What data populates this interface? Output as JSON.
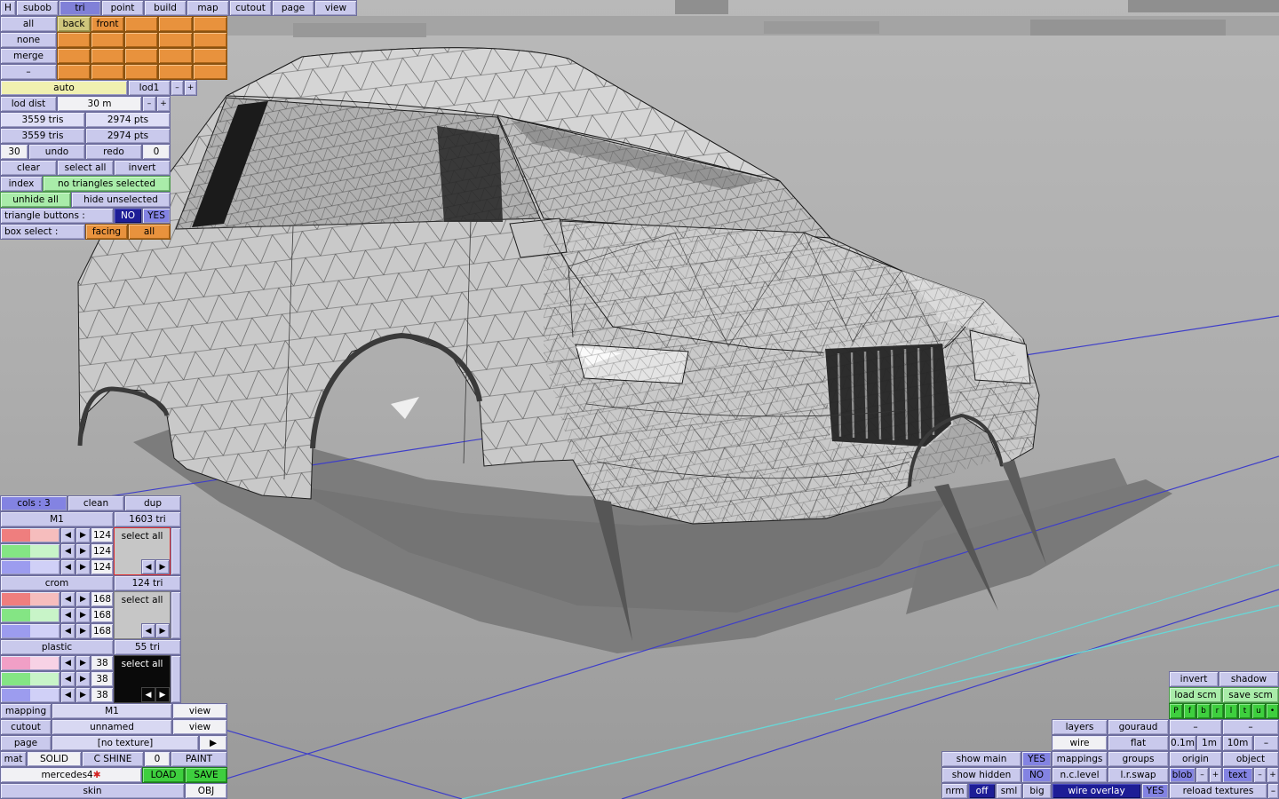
{
  "colors": {
    "panel": "#c9c9ec",
    "orange": "#e8923d",
    "yellow": "#f0f0b0",
    "tan": "#cfc67c",
    "green_light": "#a9eca9",
    "green_bright": "#3ecf3e",
    "blue_mid": "#8383e2",
    "navy": "#1d1d96",
    "viewport_gray": "#aeaeae",
    "shadow_gray": "#7c7c7c",
    "grid_blue": "#3e3ec9",
    "grid_cyan": "#68d6d6"
  },
  "menubar": {
    "h": "H",
    "items": [
      "subob",
      "tri",
      "point",
      "build",
      "map",
      "cutout",
      "page",
      "view"
    ],
    "active": "tri"
  },
  "subobject": {
    "side_buttons": [
      "all",
      "none",
      "merge",
      "–"
    ],
    "back": "back",
    "front": "front"
  },
  "lod": {
    "auto": "auto",
    "lod1": "lod1",
    "minus": "–",
    "plus": "+",
    "dist_label": "lod dist",
    "dist_value": "30 m",
    "dist_minus": "–",
    "dist_plus": "+"
  },
  "stats": {
    "row1_tris": "3559 tris",
    "row1_pts": "2974 pts",
    "row2_tris": "3559 tris",
    "row2_pts": "2974 pts"
  },
  "history": {
    "undo_count": "30",
    "undo": "undo",
    "redo": "redo",
    "redo_count": "0"
  },
  "selection": {
    "clear": "clear",
    "select_all": "select all",
    "invert": "invert",
    "index": "index",
    "status": "no triangles selected",
    "unhide_all": "unhide all",
    "hide_unselected": "hide unselected",
    "triangle_buttons_label": "triangle buttons :",
    "no": "NO",
    "yes": "YES",
    "box_select_label": "box select :",
    "facing": "facing",
    "all": "all"
  },
  "materials": {
    "cols": "cols : 3",
    "clean": "clean",
    "dup": "dup",
    "arrow_left": "◀",
    "arrow_right": "▶",
    "groups": [
      {
        "name": "M1",
        "tris": "1603 tri",
        "select_all": "select all",
        "values": [
          "124",
          "124",
          "124"
        ]
      },
      {
        "name": "crom",
        "tris": "124 tri",
        "select_all": "select all",
        "values": [
          "168",
          "168",
          "168"
        ]
      },
      {
        "name": "plastic",
        "tris": "55 tri",
        "select_all": "select all",
        "values": [
          "38",
          "38",
          "38"
        ]
      }
    ]
  },
  "mapping": {
    "mapping_label": "mapping",
    "mapping_value": "M1",
    "mapping_view": "view",
    "cutout_label": "cutout",
    "cutout_value": "unnamed",
    "cutout_view": "view",
    "page_label": "page",
    "page_value": "[no texture]",
    "page_next": "▶",
    "mat_label": "mat",
    "solid": "SOLID",
    "c_shine": "C SHINE",
    "shine_value": "0",
    "paint": "PAINT",
    "file_name": "mercedes4",
    "file_star": "✱",
    "load": "LOAD",
    "save": "SAVE",
    "skin": "skin",
    "obj": "OBJ"
  },
  "render": {
    "invert": "invert",
    "shadow": "shadow",
    "load_scm": "load scm",
    "save_scm": "save scm",
    "proj_buttons": [
      "P",
      "f",
      "b",
      "r",
      "l",
      "t",
      "u",
      "•"
    ],
    "layers": "layers",
    "gouraud": "gouraud",
    "dash_a": "–",
    "dash_b": "–",
    "wire": "wire",
    "flat": "flat",
    "grid_01": "0.1m",
    "grid_1": "1m",
    "grid_10": "10m",
    "dash_c": "–",
    "show_main": "show main",
    "show_main_val": "YES",
    "mappings": "mappings",
    "groups": "groups",
    "origin": "origin",
    "object": "object",
    "show_hidden": "show hidden",
    "show_hidden_val": "NO",
    "nc_level": "n.c.level",
    "lr_swap": "l.r.swap",
    "blob": "blob",
    "blob_minus": "–",
    "blob_plus": "+",
    "text": "text",
    "text_minus": "–",
    "text_plus": "+",
    "nrm": "nrm",
    "off": "off",
    "sml": "sml",
    "big": "big",
    "wire_overlay": "wire overlay",
    "wire_overlay_val": "YES",
    "reload_textures": "reload textures",
    "dash_d": "–"
  }
}
